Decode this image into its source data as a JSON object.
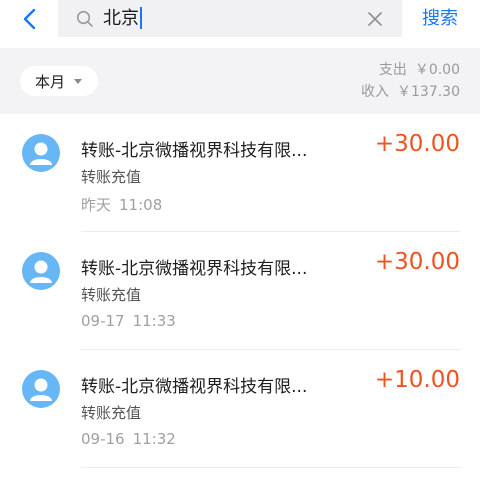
{
  "header": {
    "search_query": "北京",
    "search_button": "搜索"
  },
  "summary": {
    "month": "本月",
    "expense_label": "支出",
    "expense_value": "￥0.00",
    "income_label": "收入",
    "income_value": "￥137.30"
  },
  "transactions": [
    {
      "title": "转账-北京微播视界科技有限...",
      "type": "转账充值",
      "date": "昨天",
      "time": "11:08",
      "amount": "+30.00"
    },
    {
      "title": "转账-北京微播视界科技有限...",
      "type": "转账充值",
      "date": "09-17",
      "time": "11:33",
      "amount": "+30.00"
    },
    {
      "title": "转账-北京微播视界科技有限...",
      "type": "转账充值",
      "date": "09-16",
      "time": "11:32",
      "amount": "+10.00"
    }
  ],
  "colors": {
    "accent": "#1677ff",
    "amount": "#f0531f",
    "avatar": "#67b7f6"
  }
}
